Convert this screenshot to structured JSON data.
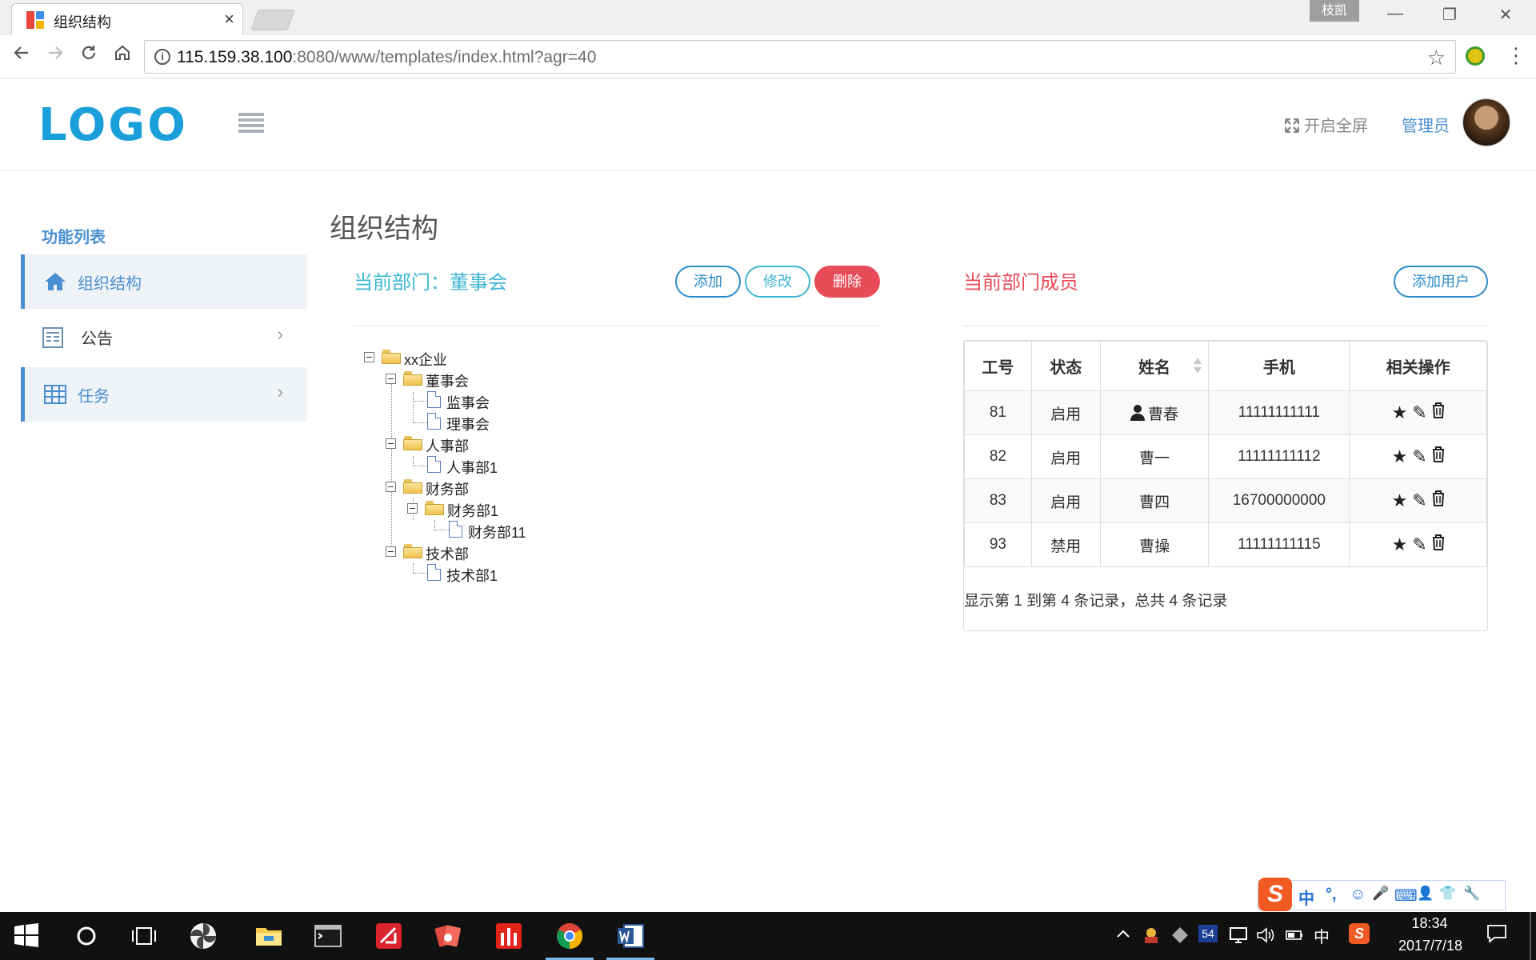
{
  "browser": {
    "tab_title": "组织结构",
    "tab_close": "×",
    "user_badge": "枝凯",
    "url_host": "115.159.38.100",
    "url_path": ":8080/www/templates/index.html?agr=40",
    "info_glyph": "i",
    "win_min": "—",
    "win_restore": "❐",
    "win_close": "✕"
  },
  "header": {
    "logo_text": "LOGO",
    "fullscreen_label": "开启全屏",
    "admin_label": "管理员"
  },
  "sidebar": {
    "title": "功能列表",
    "items": [
      {
        "label": "组织结构",
        "icon": "home-icon",
        "active": true
      },
      {
        "label": "公告",
        "icon": "notice-icon",
        "active": false
      },
      {
        "label": "任务",
        "icon": "table-icon",
        "active": false
      }
    ],
    "chevron": "›"
  },
  "main": {
    "page_title": "组织结构",
    "dept_title": "当前部门：董事会",
    "buttons": {
      "add": "添加",
      "edit": "修改",
      "delete": "删除"
    },
    "tree": [
      {
        "label": "xx企业",
        "type": "folder"
      },
      {
        "label": "董事会",
        "type": "folder"
      },
      {
        "label": "监事会",
        "type": "file"
      },
      {
        "label": "理事会",
        "type": "file"
      },
      {
        "label": "人事部",
        "type": "folder"
      },
      {
        "label": "人事部1",
        "type": "file"
      },
      {
        "label": "财务部",
        "type": "folder"
      },
      {
        "label": "财务部1",
        "type": "folder"
      },
      {
        "label": "财务部11",
        "type": "file"
      },
      {
        "label": "技术部",
        "type": "folder"
      },
      {
        "label": "技术部1",
        "type": "file"
      }
    ],
    "members_title": "当前部门成员",
    "add_user_label": "添加用户",
    "table": {
      "headers": [
        "工号",
        "状态",
        "姓名",
        "手机",
        "相关操作"
      ],
      "rows": [
        {
          "id": "81",
          "status": "启用",
          "name": "曹春",
          "phone": "11111111111",
          "has_icon": true
        },
        {
          "id": "82",
          "status": "启用",
          "name": "曹一",
          "phone": "11111111112",
          "has_icon": false
        },
        {
          "id": "83",
          "status": "启用",
          "name": "曹四",
          "phone": "16700000000",
          "has_icon": false
        },
        {
          "id": "93",
          "status": "禁用",
          "name": "曹操",
          "phone": "11111111115",
          "has_icon": false
        }
      ],
      "ops": [
        "★",
        "✎",
        "🗑"
      ],
      "pager_info": "显示第 1 到第 4 条记录，总共 4 条记录"
    }
  },
  "ime": {
    "logo": "S",
    "items": [
      "中",
      "°,",
      "☺",
      "🎤",
      "⌨",
      "👤",
      "👕",
      "🔧"
    ]
  },
  "taskbar": {
    "tray_badge": "54",
    "input_lang": "中",
    "clock_time": "18:34",
    "clock_date": "2017/7/18"
  },
  "colors": {
    "accent_blue": "#4a8fd1",
    "cyan": "#3bb6d2",
    "danger": "#e84c58",
    "logo_blue": "#1a9fdb"
  }
}
